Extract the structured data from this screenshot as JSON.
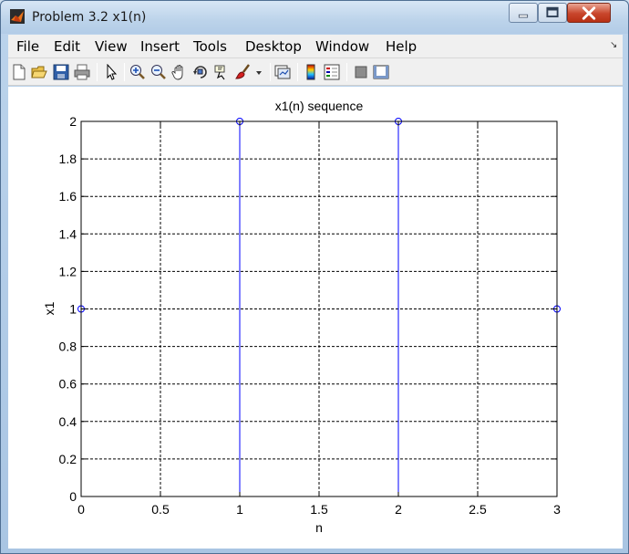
{
  "window": {
    "title": "Problem 3.2 x1(n)"
  },
  "menu": {
    "items": [
      "File",
      "Edit",
      "View",
      "Insert",
      "Tools",
      "Desktop",
      "Window",
      "Help"
    ]
  },
  "toolbar": {
    "buttons": [
      "new-figure-icon",
      "open-file-icon",
      "save-icon",
      "print-icon",
      "arrow-pointer-icon",
      "zoom-in-icon",
      "zoom-out-icon",
      "pan-hand-icon",
      "rotate-3d-icon",
      "data-cursor-icon",
      "brush-icon",
      "dropdown-arrow-icon",
      "link-plot-icon",
      "colorbar-icon",
      "legend-icon",
      "hide-plot-tools-icon",
      "show-plot-tools-icon"
    ]
  },
  "chart_data": {
    "type": "stem",
    "title": "x1(n) sequence",
    "xlabel": "n",
    "ylabel": "x1",
    "x": [
      0,
      1,
      2,
      3
    ],
    "y": [
      1,
      2,
      2,
      1
    ],
    "xlim": [
      0,
      3
    ],
    "ylim": [
      0,
      2
    ],
    "xticks": [
      0,
      0.5,
      1,
      1.5,
      2,
      2.5,
      3
    ],
    "xtick_labels": [
      "0",
      "0.5",
      "1",
      "1.5",
      "2",
      "2.5",
      "3"
    ],
    "yticks": [
      0,
      0.2,
      0.4,
      0.6,
      0.8,
      1,
      1.2,
      1.4,
      1.6,
      1.8,
      2
    ],
    "ytick_labels": [
      "0",
      "0.2",
      "0.4",
      "0.6",
      "0.8",
      "1",
      "1.2",
      "1.4",
      "1.6",
      "1.8",
      "2"
    ],
    "grid": true,
    "color": "#0000ff",
    "marker": "circle"
  }
}
